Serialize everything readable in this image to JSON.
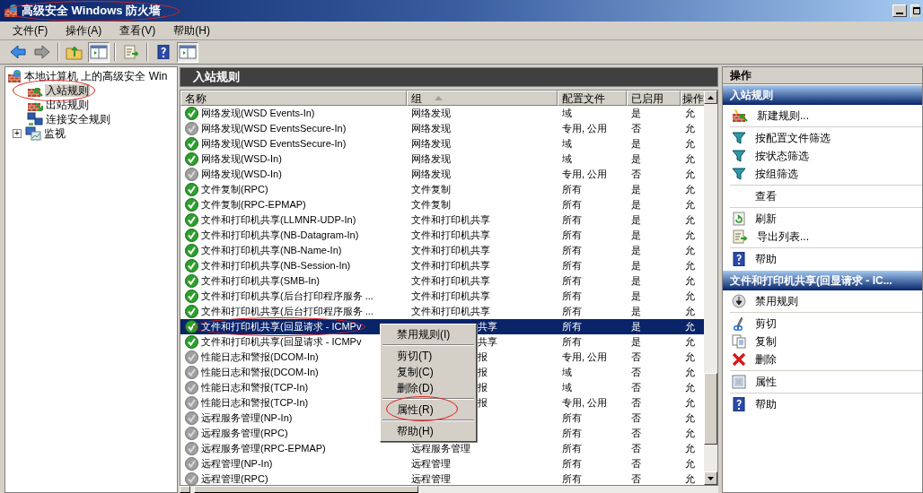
{
  "window": {
    "title": "高级安全 Windows 防火墙",
    "circled": true
  },
  "menu": [
    {
      "label": "文件(F)"
    },
    {
      "label": "操作(A)"
    },
    {
      "label": "查看(V)"
    },
    {
      "label": "帮助(H)"
    }
  ],
  "toolbar": [
    {
      "kind": "back",
      "pressed": false
    },
    {
      "kind": "forward",
      "pressed": false
    },
    {
      "kind": "separator"
    },
    {
      "kind": "up",
      "pressed": false
    },
    {
      "kind": "tree",
      "pressed": true
    },
    {
      "kind": "separator"
    },
    {
      "kind": "export",
      "pressed": false
    },
    {
      "kind": "separator"
    },
    {
      "kind": "help",
      "pressed": false
    },
    {
      "kind": "pane",
      "pressed": true
    }
  ],
  "tree": [
    {
      "label": "本地计算机 上的高级安全 Win",
      "kind": "root",
      "selected": false,
      "children": [
        {
          "label": "入站规则",
          "kind": "inbound",
          "selected": true,
          "circled": true
        },
        {
          "label": "出站规则",
          "kind": "outbound",
          "selected": false,
          "circled": false
        },
        {
          "label": "连接安全规则",
          "kind": "connsec",
          "selected": false,
          "circled": false
        },
        {
          "label": "监视",
          "kind": "monitor",
          "selected": false,
          "circled": false,
          "expander": "+"
        }
      ]
    }
  ],
  "rules": {
    "title": "入站规则",
    "columns": [
      {
        "label": "名称",
        "sorted": false
      },
      {
        "label": "组",
        "sorted": true
      },
      {
        "label": "配置文件",
        "sorted": false
      },
      {
        "label": "已启用",
        "sorted": false
      },
      {
        "label": "操作",
        "sorted": false
      }
    ],
    "rows": [
      {
        "name": "网络发现(WSD Events-In)",
        "group": "网络发现",
        "profile": "域",
        "enabled": "是",
        "action": "允",
        "active": true,
        "selected": false,
        "circled": false
      },
      {
        "name": "网络发现(WSD EventsSecure-In)",
        "group": "网络发现",
        "profile": "专用, 公用",
        "enabled": "否",
        "action": "允",
        "active": false,
        "selected": false,
        "circled": false
      },
      {
        "name": "网络发现(WSD EventsSecure-In)",
        "group": "网络发现",
        "profile": "域",
        "enabled": "是",
        "action": "允",
        "active": true,
        "selected": false,
        "circled": false
      },
      {
        "name": "网络发现(WSD-In)",
        "group": "网络发现",
        "profile": "域",
        "enabled": "是",
        "action": "允",
        "active": true,
        "selected": false,
        "circled": false
      },
      {
        "name": "网络发现(WSD-In)",
        "group": "网络发现",
        "profile": "专用, 公用",
        "enabled": "否",
        "action": "允",
        "active": false,
        "selected": false,
        "circled": false
      },
      {
        "name": "文件复制(RPC)",
        "group": "文件复制",
        "profile": "所有",
        "enabled": "是",
        "action": "允",
        "active": true,
        "selected": false,
        "circled": false
      },
      {
        "name": "文件复制(RPC-EPMAP)",
        "group": "文件复制",
        "profile": "所有",
        "enabled": "是",
        "action": "允",
        "active": true,
        "selected": false,
        "circled": false
      },
      {
        "name": "文件和打印机共享(LLMNR-UDP-In)",
        "group": "文件和打印机共享",
        "profile": "所有",
        "enabled": "是",
        "action": "允",
        "active": true,
        "selected": false,
        "circled": false
      },
      {
        "name": "文件和打印机共享(NB-Datagram-In)",
        "group": "文件和打印机共享",
        "profile": "所有",
        "enabled": "是",
        "action": "允",
        "active": true,
        "selected": false,
        "circled": false
      },
      {
        "name": "文件和打印机共享(NB-Name-In)",
        "group": "文件和打印机共享",
        "profile": "所有",
        "enabled": "是",
        "action": "允",
        "active": true,
        "selected": false,
        "circled": false
      },
      {
        "name": "文件和打印机共享(NB-Session-In)",
        "group": "文件和打印机共享",
        "profile": "所有",
        "enabled": "是",
        "action": "允",
        "active": true,
        "selected": false,
        "circled": false
      },
      {
        "name": "文件和打印机共享(SMB-In)",
        "group": "文件和打印机共享",
        "profile": "所有",
        "enabled": "是",
        "action": "允",
        "active": true,
        "selected": false,
        "circled": false
      },
      {
        "name": "文件和打印机共享(后台打印程序服务 ...",
        "group": "文件和打印机共享",
        "profile": "所有",
        "enabled": "是",
        "action": "允",
        "active": true,
        "selected": false,
        "circled": false
      },
      {
        "name": "文件和打印机共享(后台打印程序服务 ...",
        "group": "文件和打印机共享",
        "profile": "所有",
        "enabled": "是",
        "action": "允",
        "active": true,
        "selected": false,
        "circled": false
      },
      {
        "name": "文件和打印机共享(回显请求 - ICMPv",
        "group_tail": "共享",
        "profile": "所有",
        "enabled": "是",
        "action": "允",
        "active": true,
        "selected": true,
        "circled": true
      },
      {
        "name": "文件和打印机共享(回显请求 - ICMPv",
        "group_tail": "共享",
        "profile": "所有",
        "enabled": "是",
        "action": "允",
        "active": true,
        "selected": false,
        "circled": false
      },
      {
        "name": "性能日志和警报(DCOM-In)",
        "group_tail": "报",
        "profile": "专用, 公用",
        "enabled": "否",
        "action": "允",
        "active": false,
        "selected": false,
        "circled": false
      },
      {
        "name": "性能日志和警报(DCOM-In)",
        "group_tail": "报",
        "profile": "域",
        "enabled": "否",
        "action": "允",
        "active": false,
        "selected": false,
        "circled": false
      },
      {
        "name": "性能日志和警报(TCP-In)",
        "group_tail": "报",
        "profile": "域",
        "enabled": "否",
        "action": "允",
        "active": false,
        "selected": false,
        "circled": false
      },
      {
        "name": "性能日志和警报(TCP-In)",
        "group_tail": "报",
        "profile": "专用, 公用",
        "enabled": "否",
        "action": "允",
        "active": false,
        "selected": false,
        "circled": false
      },
      {
        "name": "远程服务管理(NP-In)",
        "profile": "所有",
        "enabled": "否",
        "action": "允",
        "active": false,
        "selected": false,
        "circled": false
      },
      {
        "name": "远程服务管理(RPC)",
        "profile": "所有",
        "enabled": "否",
        "action": "允",
        "active": false,
        "selected": false,
        "circled": false
      },
      {
        "name": "远程服务管理(RPC-EPMAP)",
        "group": "远程服务管理",
        "profile": "所有",
        "enabled": "否",
        "action": "允",
        "active": false,
        "selected": false,
        "circled": false
      },
      {
        "name": "远程管理(NP-In)",
        "group": "远程管理",
        "profile": "所有",
        "enabled": "否",
        "action": "允",
        "active": false,
        "selected": false,
        "circled": false
      },
      {
        "name": "远程管理(RPC)",
        "group": "远程管理",
        "profile": "所有",
        "enabled": "否",
        "action": "允",
        "active": false,
        "selected": false,
        "circled": false
      }
    ]
  },
  "context_menu": [
    {
      "kind": "item",
      "label": "禁用规则(I)",
      "circled": false
    },
    {
      "kind": "separator"
    },
    {
      "kind": "item",
      "label": "剪切(T)",
      "circled": false
    },
    {
      "kind": "item",
      "label": "复制(C)",
      "circled": false
    },
    {
      "kind": "item",
      "label": "删除(D)",
      "circled": false
    },
    {
      "kind": "separator"
    },
    {
      "kind": "item",
      "label": "属性(R)",
      "circled": true
    },
    {
      "kind": "separator"
    },
    {
      "kind": "item",
      "label": "帮助(H)",
      "circled": false
    }
  ],
  "actions": {
    "title": "操作",
    "sections": [
      {
        "title": "入站规则",
        "items": [
          {
            "kind": "new-rule",
            "label": "新建规则..."
          },
          {
            "kind": "separator"
          },
          {
            "kind": "filter",
            "label": "按配置文件筛选"
          },
          {
            "kind": "filter",
            "label": "按状态筛选"
          },
          {
            "kind": "filter",
            "label": "按组筛选"
          },
          {
            "kind": "separator"
          },
          {
            "kind": "plain",
            "label": "查看"
          },
          {
            "kind": "separator"
          },
          {
            "kind": "refresh",
            "label": "刷新"
          },
          {
            "kind": "export",
            "label": "导出列表..."
          },
          {
            "kind": "separator"
          },
          {
            "kind": "help",
            "label": "帮助"
          }
        ]
      },
      {
        "title": "文件和打印机共享(回显请求 - IC...",
        "items": [
          {
            "kind": "disable",
            "label": "禁用规则"
          },
          {
            "kind": "separator"
          },
          {
            "kind": "cut",
            "label": "剪切"
          },
          {
            "kind": "copy",
            "label": "复制"
          },
          {
            "kind": "delete",
            "label": "删除"
          },
          {
            "kind": "separator"
          },
          {
            "kind": "properties",
            "label": "属性"
          },
          {
            "kind": "separator"
          },
          {
            "kind": "help",
            "label": "帮助"
          }
        ]
      }
    ]
  }
}
